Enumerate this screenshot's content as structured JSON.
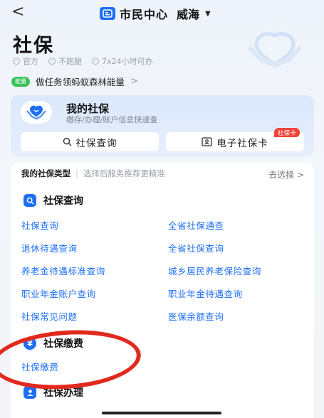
{
  "topbar": {
    "back": "<",
    "brand": "市民中心",
    "city": "威海",
    "caret": "▼"
  },
  "header": {
    "title": "社保",
    "features": [
      "官方",
      "不跑腿",
      "7x24小时可办"
    ]
  },
  "promo": {
    "badge": "能量",
    "text": "做任务领蚂蚁森林能量",
    "arrow": ">"
  },
  "my_social": {
    "title": "我的社保",
    "subtitle": "缴存/办理/账户信息快速查",
    "query_button": "社保查询",
    "card_button": "电子社保卡",
    "card_tag": "社保卡"
  },
  "types": {
    "label": "我的社保类型",
    "separator": "|",
    "hint": "选择后服务推荐更精准",
    "action": "去选择 >"
  },
  "sections": {
    "query": {
      "title": "社保查询",
      "links": [
        "社保查询",
        "全省社保通查",
        "退休待遇查询",
        "全省社保查询",
        "养老金待遇标准查询",
        "城乡居民养老保险查询",
        "职业年金账户查询",
        "职业年金待遇查询",
        "社保常见问题",
        "医保余额查询"
      ]
    },
    "payment": {
      "title": "社保缴费",
      "links": [
        "社保缴费"
      ]
    },
    "handle": {
      "title": "社保办理"
    }
  },
  "colors": {
    "accent": "#1e6ff5",
    "annotation": "#e12a1e",
    "tag": "#f04438"
  }
}
